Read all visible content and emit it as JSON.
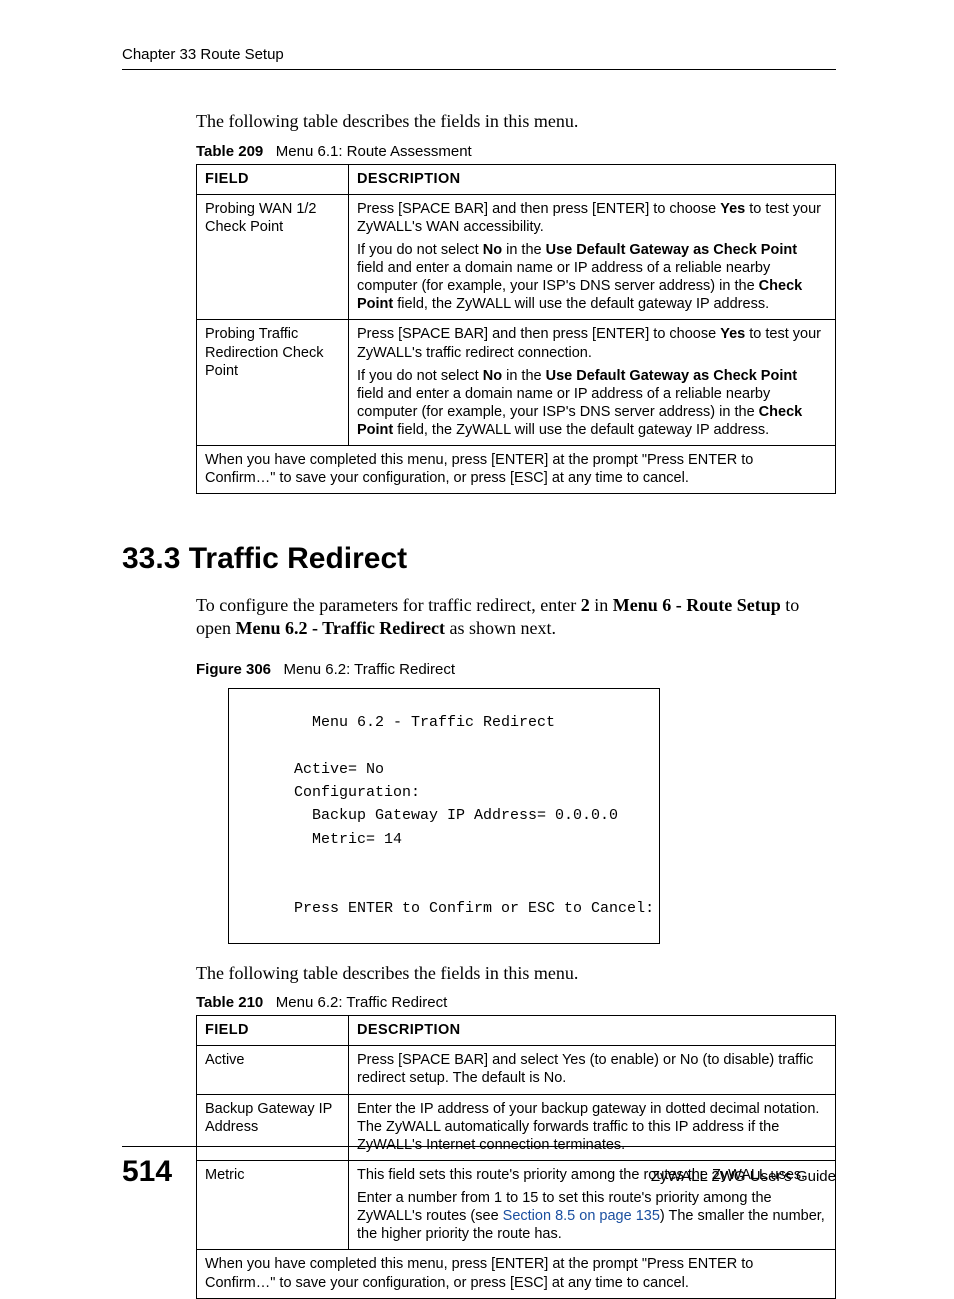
{
  "runningHead": "Chapter 33 Route Setup",
  "introPara1": "The following table describes the fields in this menu.",
  "table209": {
    "captionLabel": "Table 209",
    "captionText": "Menu 6.1: Route Assessment",
    "headField": "FIELD",
    "headDesc": "DESCRIPTION",
    "rows": [
      {
        "field": "Probing WAN 1/2 Check Point",
        "desc_p1_a": "Press [SPACE BAR] and then press [ENTER] to choose ",
        "desc_p1_bold1": "Yes",
        "desc_p1_b": " to test your ZyWALL's WAN accessibility.",
        "desc_p2_a": "If you do not select ",
        "desc_p2_bold1": "No",
        "desc_p2_b": " in the ",
        "desc_p2_bold2": "Use Default Gateway as Check Point",
        "desc_p2_c": " field and enter a domain name or IP address of a reliable nearby computer (for example, your ISP's DNS server address) in the ",
        "desc_p2_bold3": "Check Point",
        "desc_p2_d": " field, the ZyWALL will use the default gateway IP address."
      },
      {
        "field": "Probing Traffic Redirection Check Point",
        "desc_p1_a": "Press [SPACE BAR] and then press [ENTER] to choose ",
        "desc_p1_bold1": "Yes",
        "desc_p1_b": " to test your ZyWALL's traffic redirect connection.",
        "desc_p2_a": "If you do not select ",
        "desc_p2_bold1": "No",
        "desc_p2_b": " in the ",
        "desc_p2_bold2": "Use Default Gateway as Check Point",
        "desc_p2_c": " field and enter a domain name or IP address of a reliable nearby computer (for example, your ISP's DNS server address) in the ",
        "desc_p2_bold3": "Check Point",
        "desc_p2_d": " field, the ZyWALL will use the default gateway IP address."
      }
    ],
    "footer": "When you have completed this menu, press [ENTER] at the prompt \"Press ENTER to Confirm…\" to save your configuration, or press [ESC] at any time to cancel."
  },
  "section": {
    "heading": "33.3  Traffic Redirect",
    "para_a": "To configure the parameters for traffic redirect, enter ",
    "para_bold1": "2",
    "para_b": " in ",
    "para_bold2": "Menu 6 - Route Setup",
    "para_c": " to open ",
    "para_bold3": "Menu 6.2 - Traffic Redirect",
    "para_d": " as shown next."
  },
  "figure306": {
    "captionLabel": "Figure 306",
    "captionText": "Menu 6.2: Traffic Redirect",
    "line1": "       Menu 6.2 - Traffic Redirect",
    "line2": "     Active= No",
    "line3": "     Configuration:",
    "line4": "       Backup Gateway IP Address= 0.0.0.0",
    "line5": "       Metric= 14",
    "line6": "     Press ENTER to Confirm or ESC to Cancel:"
  },
  "introPara2": "The following table describes the fields in this menu.",
  "table210": {
    "captionLabel": "Table 210",
    "captionText": "Menu 6.2: Traffic Redirect",
    "headField": "FIELD",
    "headDesc": "DESCRIPTION",
    "rows": [
      {
        "field": "Active",
        "desc": "Press [SPACE BAR] and select Yes (to enable) or No (to disable) traffic redirect setup. The default is No."
      },
      {
        "field": "Backup Gateway IP Address",
        "desc": "Enter the IP address of your backup gateway in dotted decimal notation. The ZyWALL automatically forwards traffic to this IP address if the ZyWALL's Internet connection terminates."
      },
      {
        "field": "Metric",
        "desc_p1": "This field sets this route's priority among the routes the ZyWALL uses.",
        "desc_p2_a": "Enter a number from 1 to 15 to set this route's priority among the ZyWALL's routes (see ",
        "desc_p2_link": "Section 8.5 on page 135",
        "desc_p2_b": ") The smaller the number, the higher priority the route has."
      }
    ],
    "footer": "When you have completed this menu, press [ENTER] at the prompt \"Press ENTER to Confirm…\" to save your configuration, or press [ESC] at any time to cancel."
  },
  "footer": {
    "pageNum": "514",
    "guide": "ZyWALL 2WG User's Guide"
  }
}
